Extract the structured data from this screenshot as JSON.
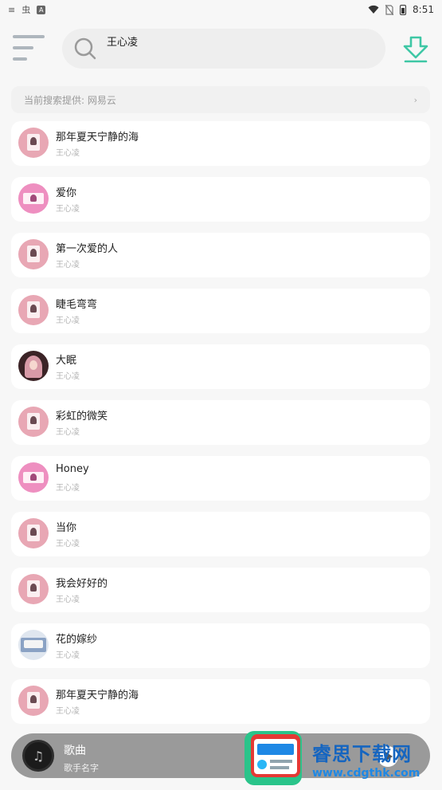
{
  "status_bar": {
    "time": "8:51",
    "left_glyph": "虫",
    "badge": "A",
    "menu_glyph": "≡",
    "icons": [
      "keyboard-icon",
      "wifi-icon",
      "no-sim-icon",
      "battery-icon"
    ]
  },
  "header": {
    "search_value": "王心凌",
    "icons": [
      "menu-icon",
      "search-icon",
      "download-icon"
    ]
  },
  "source_bar": {
    "label": "当前搜索提供: 网易云",
    "arrow": "›"
  },
  "songs": [
    {
      "title": "那年夏天宁静的海",
      "artist": "王心凌"
    },
    {
      "title": "爱你",
      "artist": "王心凌"
    },
    {
      "title": "第一次爱的人",
      "artist": "王心凌"
    },
    {
      "title": "睫毛弯弯",
      "artist": "王心凌"
    },
    {
      "title": "大眠",
      "artist": "王心凌"
    },
    {
      "title": "彩虹的微笑",
      "artist": "王心凌"
    },
    {
      "title": "Honey",
      "artist": "王心凌"
    },
    {
      "title": "当你",
      "artist": "王心凌"
    },
    {
      "title": "我会好好的",
      "artist": "王心凌"
    },
    {
      "title": "花的嫁纱",
      "artist": "王心凌"
    },
    {
      "title": "那年夏天宁静的海",
      "artist": "王心凌"
    }
  ],
  "player": {
    "title": "歌曲",
    "artist": "歌手名字"
  },
  "watermark": {
    "title": "睿思下载网",
    "url": "www.cdgthk.com"
  },
  "colors": {
    "accent_green": "#3ec7a5",
    "background": "#f7f7f7",
    "card": "#ffffff",
    "player_bar": "#9a9a9a",
    "watermark_blue": "#1565c0"
  }
}
